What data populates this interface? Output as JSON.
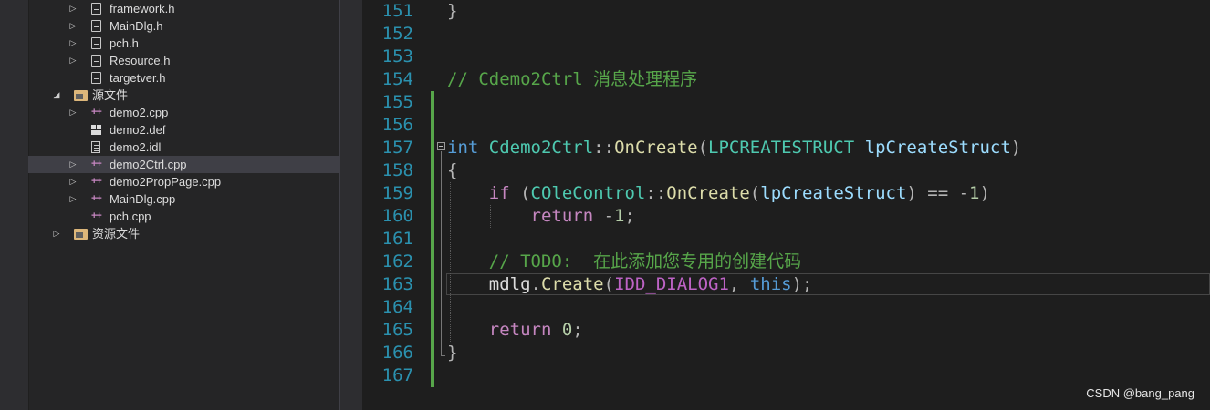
{
  "explorer": {
    "items": [
      {
        "label": "framework.h",
        "icon": "header-file-icon",
        "expandable": true,
        "level": 2
      },
      {
        "label": "MainDlg.h",
        "icon": "header-file-icon",
        "expandable": true,
        "level": 2
      },
      {
        "label": "pch.h",
        "icon": "header-file-icon",
        "expandable": true,
        "level": 2
      },
      {
        "label": "Resource.h",
        "icon": "header-file-icon",
        "expandable": true,
        "level": 2
      },
      {
        "label": "targetver.h",
        "icon": "header-file-icon",
        "expandable": false,
        "level": 2
      },
      {
        "label": "源文件",
        "icon": "folder-icon",
        "expandable": true,
        "expanded": true,
        "level": 1
      },
      {
        "label": "demo2.cpp",
        "icon": "cpp-file-icon",
        "expandable": true,
        "level": 2
      },
      {
        "label": "demo2.def",
        "icon": "def-file-icon",
        "expandable": false,
        "level": 2
      },
      {
        "label": "demo2.idl",
        "icon": "idl-file-icon",
        "expandable": false,
        "level": 2
      },
      {
        "label": "demo2Ctrl.cpp",
        "icon": "cpp-file-icon",
        "expandable": true,
        "level": 2,
        "selected": true
      },
      {
        "label": "demo2PropPage.cpp",
        "icon": "cpp-file-icon",
        "expandable": true,
        "level": 2
      },
      {
        "label": "MainDlg.cpp",
        "icon": "cpp-file-icon",
        "expandable": true,
        "level": 2
      },
      {
        "label": "pch.cpp",
        "icon": "cpp-file-icon",
        "expandable": false,
        "level": 2
      },
      {
        "label": "资源文件",
        "icon": "folder-icon",
        "expandable": true,
        "expanded": false,
        "level": 1
      }
    ],
    "cpp_glyph": "++",
    "expand_glyph": "▷",
    "expanded_glyph": "◢"
  },
  "editor": {
    "line_numbers": [
      "151",
      "152",
      "153",
      "154",
      "155",
      "156",
      "157",
      "158",
      "159",
      "160",
      "161",
      "162",
      "163",
      "164",
      "165",
      "166",
      "167"
    ],
    "current_line": "163",
    "lines": [
      [
        {
          "t": "}",
          "c": "op"
        }
      ],
      [],
      [],
      [
        {
          "t": "// Cdemo2Ctrl 消息处理程序",
          "c": "cm"
        }
      ],
      [],
      [],
      [
        {
          "t": "int",
          "c": "kw"
        },
        {
          "t": " ",
          "c": ""
        },
        {
          "t": "Cdemo2Ctrl",
          "c": "ty"
        },
        {
          "t": "::",
          "c": "op"
        },
        {
          "t": "OnCreate",
          "c": "fn"
        },
        {
          "t": "(",
          "c": "op"
        },
        {
          "t": "LPCREATESTRUCT",
          "c": "ty"
        },
        {
          "t": " ",
          "c": ""
        },
        {
          "t": "lpCreateStruct",
          "c": "par"
        },
        {
          "t": ")",
          "c": "op"
        }
      ],
      [
        {
          "t": "{",
          "c": "op"
        }
      ],
      [
        {
          "t": "    ",
          "c": ""
        },
        {
          "t": "if",
          "c": "cl"
        },
        {
          "t": " (",
          "c": "op"
        },
        {
          "t": "COleControl",
          "c": "ty"
        },
        {
          "t": "::",
          "c": "op"
        },
        {
          "t": "OnCreate",
          "c": "fn"
        },
        {
          "t": "(",
          "c": "op"
        },
        {
          "t": "lpCreateStruct",
          "c": "par"
        },
        {
          "t": ") == -",
          "c": "op"
        },
        {
          "t": "1",
          "c": "nm"
        },
        {
          "t": ")",
          "c": "op"
        }
      ],
      [
        {
          "t": "        ",
          "c": ""
        },
        {
          "t": "return",
          "c": "cl"
        },
        {
          "t": " -",
          "c": "op"
        },
        {
          "t": "1",
          "c": "nm"
        },
        {
          "t": ";",
          "c": "op"
        }
      ],
      [],
      [
        {
          "t": "    ",
          "c": ""
        },
        {
          "t": "// TODO:  在此添加您专用的创建代码",
          "c": "cm"
        }
      ],
      [
        {
          "t": "    ",
          "c": ""
        },
        {
          "t": "mdlg",
          "c": ""
        },
        {
          "t": ".",
          "c": "op"
        },
        {
          "t": "Create",
          "c": "fn"
        },
        {
          "t": "(",
          "c": "op"
        },
        {
          "t": "IDD_DIALOG1",
          "c": "mac"
        },
        {
          "t": ", ",
          "c": "op"
        },
        {
          "t": "this",
          "c": "kw"
        },
        {
          "t": ");",
          "c": "op"
        }
      ],
      [],
      [
        {
          "t": "    ",
          "c": ""
        },
        {
          "t": "return",
          "c": "cl"
        },
        {
          "t": " ",
          "c": ""
        },
        {
          "t": "0",
          "c": "nm"
        },
        {
          "t": ";",
          "c": "op"
        }
      ],
      [
        {
          "t": "}",
          "c": "op"
        }
      ],
      []
    ]
  },
  "watermark": "CSDN @bang_pang",
  "colors": {
    "background": "#1e1e1e",
    "explorer_bg": "#252526",
    "line_number": "#2b91af",
    "comment": "#57a64a",
    "keyword": "#569cd6",
    "function": "#dcdcaa",
    "type": "#4ec9b0",
    "change_marker": "#57a64a"
  }
}
